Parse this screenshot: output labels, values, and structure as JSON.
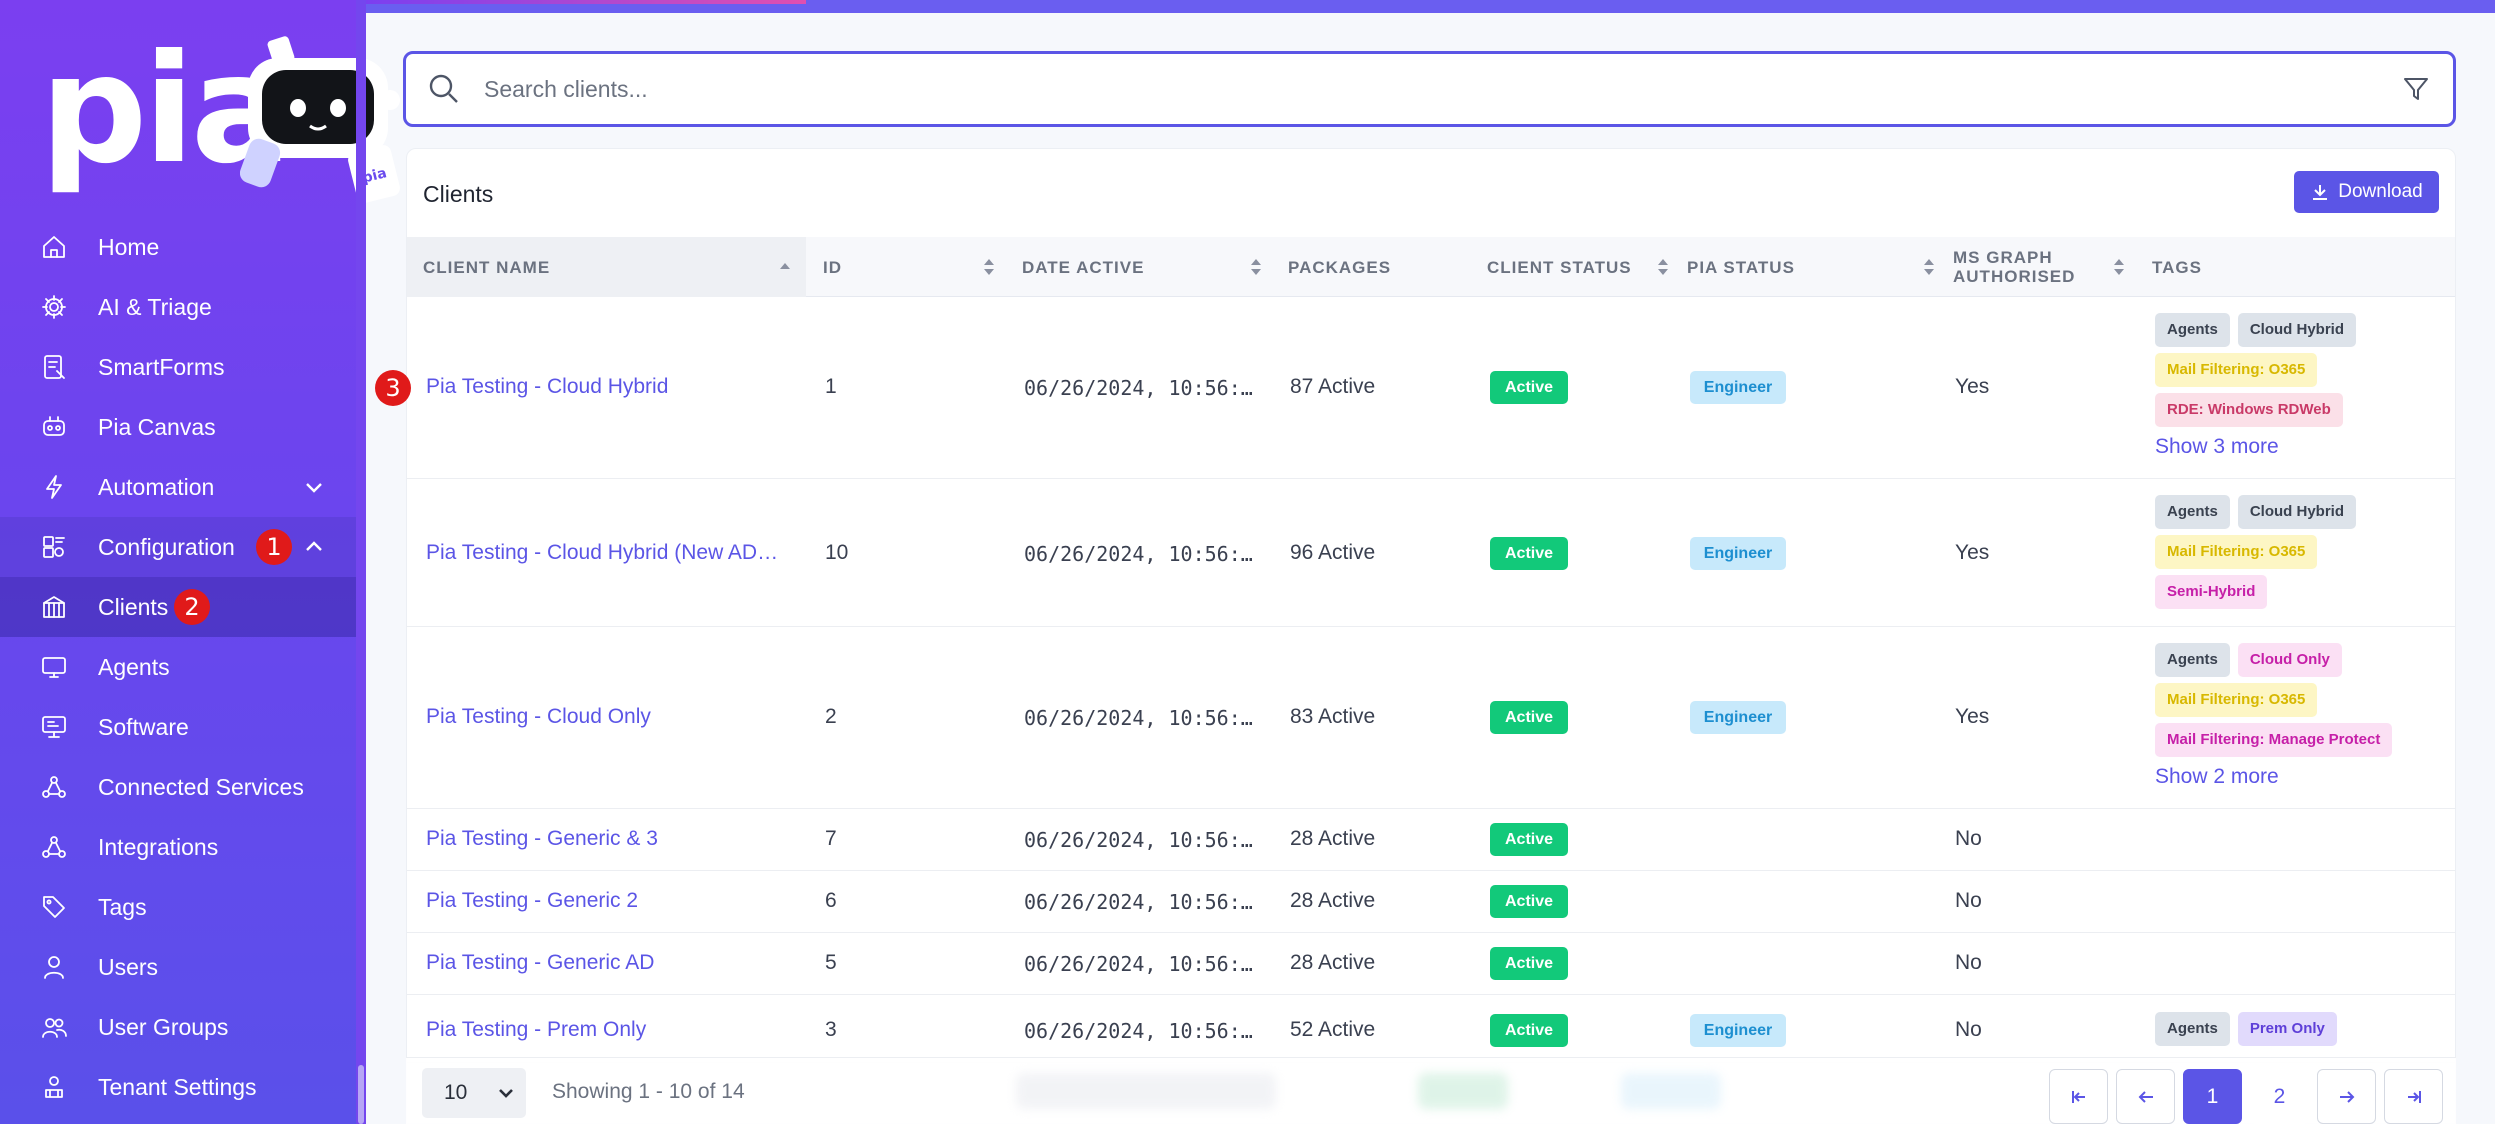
{
  "brand": {
    "logo_text": "pia",
    "mascot_text": "pia"
  },
  "colors": {
    "accent": "#5b55e6",
    "sidebar_top": "#7b3ff0",
    "sidebar_bottom": "#5a50ea",
    "active_badge": "#12c97a",
    "step_badge": "#e01a1a"
  },
  "sidebar": {
    "items": [
      {
        "label": "Home",
        "icon": "home-icon"
      },
      {
        "label": "AI & Triage",
        "icon": "gear-icon"
      },
      {
        "label": "SmartForms",
        "icon": "form-icon"
      },
      {
        "label": "Pia Canvas",
        "icon": "canvas-icon"
      },
      {
        "label": "Automation",
        "icon": "lightning-icon"
      },
      {
        "label": "Configuration",
        "icon": "configuration-icon"
      },
      {
        "label": "Clients",
        "icon": "clients-icon"
      },
      {
        "label": "Agents",
        "icon": "monitor-icon"
      },
      {
        "label": "Software",
        "icon": "software-icon"
      },
      {
        "label": "Connected Services",
        "icon": "connected-services-icon"
      },
      {
        "label": "Integrations",
        "icon": "integrations-icon"
      },
      {
        "label": "Tags",
        "icon": "tag-icon"
      },
      {
        "label": "Users",
        "icon": "user-icon"
      },
      {
        "label": "User Groups",
        "icon": "user-group-icon"
      },
      {
        "label": "Tenant Settings",
        "icon": "tenant-settings-icon"
      }
    ]
  },
  "steps": {
    "one": "1",
    "two": "2",
    "three": "3"
  },
  "search": {
    "placeholder": "Search clients..."
  },
  "card": {
    "title": "Clients",
    "download_label": "Download"
  },
  "columns": {
    "client_name": "CLIENT NAME",
    "id": "ID",
    "date_active": "DATE ACTIVE",
    "packages": "PACKAGES",
    "client_status": "CLIENT STATUS",
    "pia_status": "PIA STATUS",
    "ms_graph_line1": "MS GRAPH",
    "ms_graph_line2": "AUTHORISED",
    "tags": "TAGS"
  },
  "rows": [
    {
      "name": "Pia Testing - Cloud Hybrid",
      "id": "1",
      "date": "06/26/2024, 10:56:…",
      "packages": "87 Active",
      "client_status": "Active",
      "pia_status": "Engineer",
      "ms_graph": "Yes",
      "tags": [
        "Agents",
        "Cloud Hybrid",
        "Mail Filtering: O365",
        "RDE: Windows RDWeb"
      ],
      "show_more": "Show 3 more"
    },
    {
      "name": "Pia Testing - Cloud Hybrid (New AD…",
      "id": "10",
      "date": "06/26/2024, 10:56:…",
      "packages": "96 Active",
      "client_status": "Active",
      "pia_status": "Engineer",
      "ms_graph": "Yes",
      "tags": [
        "Agents",
        "Cloud Hybrid",
        "Mail Filtering: O365",
        "Semi-Hybrid"
      ]
    },
    {
      "name": "Pia Testing - Cloud Only",
      "id": "2",
      "date": "06/26/2024, 10:56:…",
      "packages": "83 Active",
      "client_status": "Active",
      "pia_status": "Engineer",
      "ms_graph": "Yes",
      "tags": [
        "Agents",
        "Cloud Only",
        "Mail Filtering: O365",
        "Mail Filtering: Manage Protect"
      ],
      "show_more": "Show 2 more"
    },
    {
      "name": "Pia Testing - Generic & 3",
      "id": "7",
      "date": "06/26/2024, 10:56:…",
      "packages": "28 Active",
      "client_status": "Active",
      "ms_graph": "No"
    },
    {
      "name": "Pia Testing - Generic 2",
      "id": "6",
      "date": "06/26/2024, 10:56:…",
      "packages": "28 Active",
      "client_status": "Active",
      "ms_graph": "No"
    },
    {
      "name": "Pia Testing - Generic AD",
      "id": "5",
      "date": "06/26/2024, 10:56:…",
      "packages": "28 Active",
      "client_status": "Active",
      "ms_graph": "No"
    },
    {
      "name": "Pia Testing - Prem Only",
      "id": "3",
      "date": "06/26/2024, 10:56:…",
      "packages": "52 Active",
      "client_status": "Active",
      "pia_status": "Engineer",
      "ms_graph": "No",
      "tags": [
        "Agents",
        "Prem Only"
      ]
    }
  ],
  "footer": {
    "page_size": "10",
    "showing": "Showing 1 - 10 of 14",
    "pages": [
      "1",
      "2"
    ],
    "current_page": "1"
  }
}
